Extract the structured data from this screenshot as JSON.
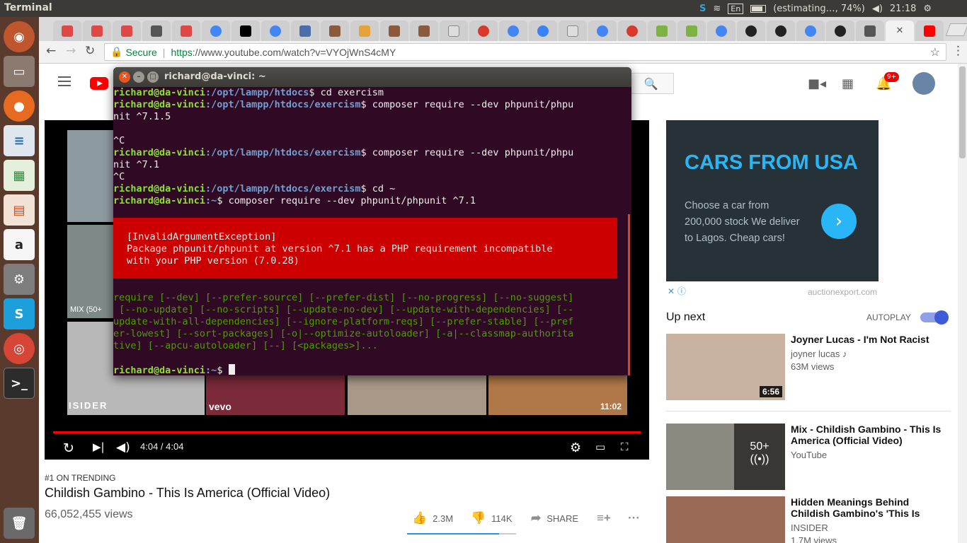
{
  "system": {
    "app_title": "Terminal",
    "language": "En",
    "battery": "(estimating…, 74%)",
    "clock": "21:18"
  },
  "browser": {
    "secure_label": "Secure",
    "url_scheme": "https",
    "url_rest": "://www.youtube.com/watch?v=VYOjWnS4cMY"
  },
  "youtube": {
    "notification_count": "9+",
    "player": {
      "time": "4:04 / 4:04",
      "mix_label": "MIX (50+",
      "thumb_duration": "11:02",
      "insider_text": "ISIDER",
      "vevo_text": "vevo"
    },
    "video": {
      "trending": "#1 ON TRENDING",
      "title": "Childish Gambino - This Is America (Official Video)",
      "views": "66,052,455 views",
      "likes": "2.3M",
      "dislikes": "114K",
      "share": "SHARE"
    },
    "ad": {
      "title": "CARS FROM USA",
      "text": "Choose a car from 200,000 stock We deliver to Lagos. Cheap cars!",
      "domain": "auctionexport.com"
    },
    "up_next": {
      "heading": "Up next",
      "autoplay": "AUTOPLAY",
      "items": [
        {
          "title": "Joyner Lucas - I'm Not Racist",
          "channel": "joyner lucas ♪",
          "views": "63M views",
          "duration": "6:56"
        },
        {
          "title": "Mix - Childish Gambino - This Is America (Official Video)",
          "channel": "YouTube",
          "views": "",
          "duration": "50+"
        },
        {
          "title": "Hidden Meanings Behind Childish Gambino's 'This Is",
          "channel": "INSIDER",
          "views": "1.7M views",
          "duration": ""
        }
      ]
    }
  },
  "terminal": {
    "title": "richard@da-vinci: ~",
    "user_host": "richard@da-vinci",
    "lines": {
      "l1_path": ":/opt/lampp/htdocs",
      "l1_cmd": "$ cd exercism",
      "l2_path": ":/opt/lampp/htdocs/exercism",
      "l2_cmd": "$ composer require --dev phpunit/phpu",
      "l2_wrap": "nit ^7.1.5",
      "ctrl_c": "^C",
      "l3_cmd": "$ composer require --dev phpunit/phpu",
      "l3_wrap": "nit ^7.1",
      "l4_cmd": "$ cd ~",
      "l5_path": ":~",
      "l5_cmd": "$ composer require --dev phpunit/phpunit ^7.1",
      "err1": "[InvalidArgumentException]",
      "err2": "Package phpunit/phpunit at version ^7.1 has a PHP requirement incompatible",
      "err3": "with your PHP version (7.0.28)",
      "u1": "require [--dev] [--prefer-source] [--prefer-dist] [--no-progress] [--no-suggest]",
      "u2": " [--no-update] [--no-scripts] [--update-no-dev] [--update-with-dependencies] [--",
      "u3": "update-with-all-dependencies] [--ignore-platform-reqs] [--prefer-stable] [--pref",
      "u4": "er-lowest] [--sort-packages] [-o|--optimize-autoloader] [-a|--classmap-authorita",
      "u5": "tive] [--apcu-autoloader] [--] [<packages>]...",
      "prompt_end": "$ "
    }
  },
  "colors": {
    "terminal_bg": "#300a24",
    "prompt_green": "#8ae234",
    "path_blue": "#729fcf",
    "error_red": "#cc0000",
    "usage_green": "#4e9a06",
    "ad_blue": "#29b6f6"
  }
}
